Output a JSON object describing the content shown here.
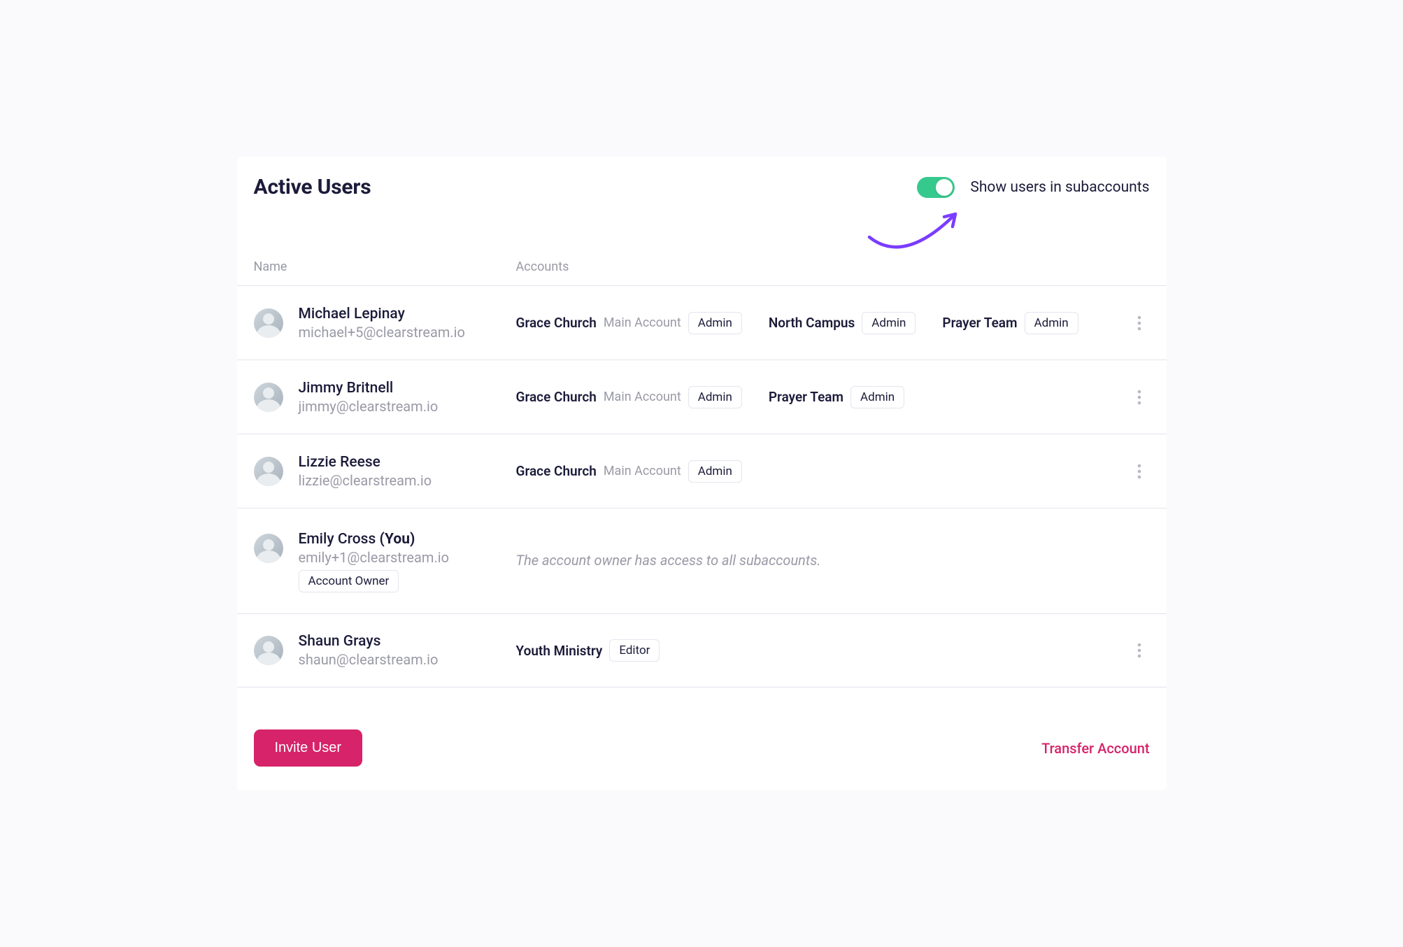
{
  "header": {
    "title": "Active Users",
    "toggle_label": "Show users in subaccounts"
  },
  "columns": {
    "name": "Name",
    "accounts": "Accounts"
  },
  "users": [
    {
      "name": "Michael Lepinay",
      "email": "michael+5@clearstream.io",
      "you": false,
      "owner": false,
      "owner_badge": "",
      "accounts": [
        {
          "name": "Grace Church",
          "sub": "Main Account",
          "role": "Admin"
        },
        {
          "name": "North Campus",
          "sub": "",
          "role": "Admin"
        },
        {
          "name": "Prayer Team",
          "sub": "",
          "role": "Admin"
        }
      ]
    },
    {
      "name": "Jimmy Britnell",
      "email": "jimmy@clearstream.io",
      "you": false,
      "owner": false,
      "owner_badge": "",
      "accounts": [
        {
          "name": "Grace Church",
          "sub": "Main Account",
          "role": "Admin"
        },
        {
          "name": "Prayer Team",
          "sub": "",
          "role": "Admin"
        }
      ]
    },
    {
      "name": "Lizzie Reese",
      "email": "lizzie@clearstream.io",
      "you": false,
      "owner": false,
      "owner_badge": "",
      "accounts": [
        {
          "name": "Grace Church",
          "sub": "Main Account",
          "role": "Admin"
        }
      ]
    },
    {
      "name": "Emily Cross",
      "email": "emily+1@clearstream.io",
      "you": true,
      "you_label": "(You)",
      "owner": true,
      "owner_badge": "Account Owner",
      "owner_note": "The account owner has access to all subaccounts.",
      "accounts": []
    },
    {
      "name": "Shaun Grays",
      "email": "shaun@clearstream.io",
      "you": false,
      "owner": false,
      "owner_badge": "",
      "accounts": [
        {
          "name": "Youth Ministry",
          "sub": "",
          "role": "Editor"
        }
      ]
    }
  ],
  "footer": {
    "invite": "Invite User",
    "transfer": "Transfer Account"
  }
}
